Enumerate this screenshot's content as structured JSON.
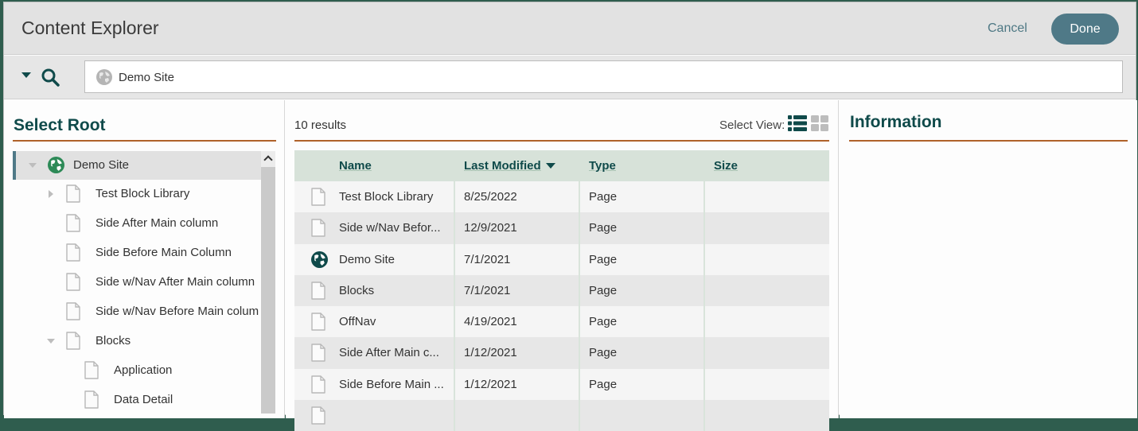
{
  "header": {
    "title": "Content Explorer",
    "cancel_label": "Cancel",
    "done_label": "Done"
  },
  "search": {
    "value": "Demo Site",
    "icon": "globe-icon",
    "dropdown_icon": "caret-down-icon",
    "search_icon": "search-icon"
  },
  "left_panel": {
    "title": "Select Root",
    "tree": [
      {
        "label": "Demo Site",
        "icon": "globe-icon",
        "toggle": "expanded",
        "level": 0,
        "selected": true
      },
      {
        "label": "Test Block Library",
        "icon": "page-icon",
        "toggle": "collapsed",
        "level": 1
      },
      {
        "label": "Side After Main column",
        "icon": "page-icon",
        "toggle": "none",
        "level": 1
      },
      {
        "label": "Side Before Main Column",
        "icon": "page-icon",
        "toggle": "none",
        "level": 1
      },
      {
        "label": "Side w/Nav After Main column",
        "icon": "page-icon",
        "toggle": "none",
        "level": 1
      },
      {
        "label": "Side w/Nav Before Main colum",
        "icon": "page-icon",
        "toggle": "none",
        "level": 1
      },
      {
        "label": "Blocks",
        "icon": "page-icon",
        "toggle": "expanded",
        "level": 1
      },
      {
        "label": "Application",
        "icon": "page-icon",
        "toggle": "none",
        "level": 2
      },
      {
        "label": "Data Detail",
        "icon": "page-icon",
        "toggle": "none",
        "level": 2
      }
    ]
  },
  "middle_panel": {
    "results_label": "10 results",
    "select_view_label": "Select View:",
    "views": [
      {
        "name": "list-view",
        "active": true
      },
      {
        "name": "grid-view",
        "active": false
      }
    ],
    "columns": [
      {
        "label": "Name"
      },
      {
        "label": "Last Modified",
        "sorted": "desc"
      },
      {
        "label": "Type"
      },
      {
        "label": "Size"
      }
    ],
    "rows": [
      {
        "icon": "page-icon",
        "name": "Test Block Library",
        "modified": "8/25/2022",
        "type": "Page",
        "size": ""
      },
      {
        "icon": "page-icon",
        "name": "Side w/Nav Befor...",
        "modified": "12/9/2021",
        "type": "Page",
        "size": ""
      },
      {
        "icon": "globe-icon",
        "name": "Demo Site",
        "modified": "7/1/2021",
        "type": "Page",
        "size": ""
      },
      {
        "icon": "page-icon",
        "name": "Blocks",
        "modified": "7/1/2021",
        "type": "Page",
        "size": ""
      },
      {
        "icon": "page-icon",
        "name": "OffNav",
        "modified": "4/19/2021",
        "type": "Page",
        "size": ""
      },
      {
        "icon": "page-icon",
        "name": "Side After Main c...",
        "modified": "1/12/2021",
        "type": "Page",
        "size": ""
      },
      {
        "icon": "page-icon",
        "name": "Side Before Main ...",
        "modified": "1/12/2021",
        "type": "Page",
        "size": ""
      },
      {
        "icon": "page-icon",
        "name": "",
        "modified": "",
        "type": "",
        "size": ""
      }
    ]
  },
  "right_panel": {
    "title": "Information"
  },
  "colors": {
    "accent": "#0f4a4a",
    "button": "#4f7987",
    "rule": "#b0622a",
    "table_header": "#d7e2d9"
  }
}
